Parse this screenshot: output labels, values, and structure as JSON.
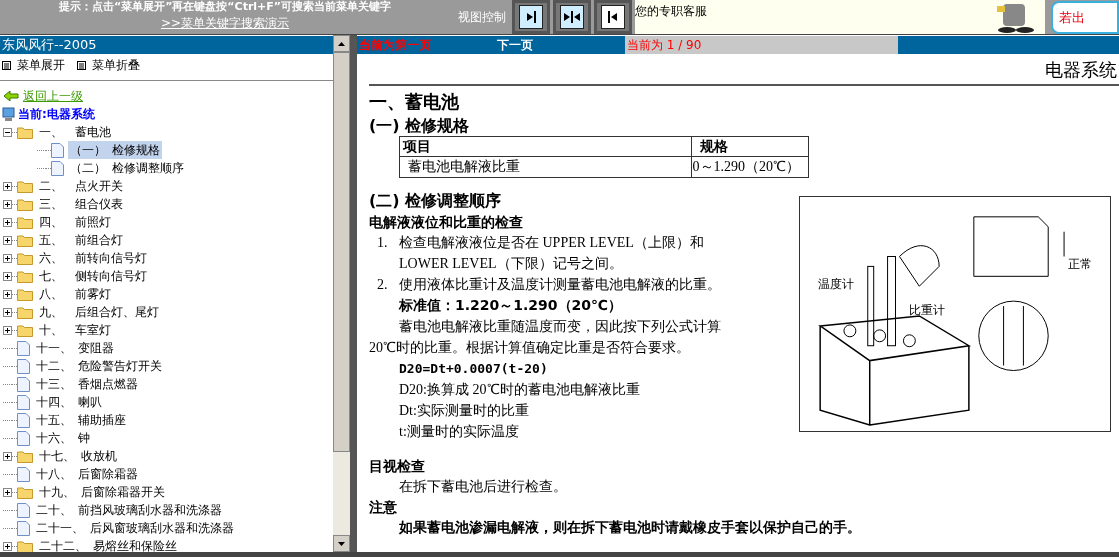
{
  "banner": {
    "hint": "提示：点击“菜单展开”再在键盘按“Ctrl+F”可搜索当前菜单关键字",
    "demo_link": ">>菜单关键字搜索演示",
    "view_label": "视图控制",
    "view_buttons": [
      {
        "kind": "right",
        "selected": true
      },
      {
        "kind": "split",
        "selected": true
      },
      {
        "kind": "left",
        "selected": false
      }
    ],
    "service": "您的专职客服",
    "badge": "若出"
  },
  "sidebar": {
    "title": "东风风行--2005",
    "menu_buttons": [
      "菜单展开",
      "菜单折叠"
    ],
    "back_link": "返回上一级",
    "current": "当前:电器系统",
    "tree": [
      {
        "num": "一、",
        "label": "蓄电池",
        "kind": "folder",
        "expanded": true,
        "children": [
          {
            "num": "（一）",
            "label": "检修规格",
            "kind": "page",
            "selected": true
          },
          {
            "num": "（二）",
            "label": "检修调整顺序",
            "kind": "page",
            "selected": false
          }
        ]
      },
      {
        "num": "二、",
        "label": "点火开关",
        "kind": "folder",
        "expanded": false
      },
      {
        "num": "三、",
        "label": "组合仪表",
        "kind": "folder",
        "expanded": false
      },
      {
        "num": "四、",
        "label": "前照灯",
        "kind": "folder",
        "expanded": false
      },
      {
        "num": "五、",
        "label": "前组合灯",
        "kind": "folder",
        "expanded": false
      },
      {
        "num": "六、",
        "label": "前转向信号灯",
        "kind": "folder",
        "expanded": false
      },
      {
        "num": "七、",
        "label": "侧转向信号灯",
        "kind": "folder",
        "expanded": false
      },
      {
        "num": "八、",
        "label": "前雾灯",
        "kind": "folder",
        "expanded": false
      },
      {
        "num": "九、",
        "label": "后组合灯、尾灯",
        "kind": "folder",
        "expanded": false
      },
      {
        "num": "十、",
        "label": "车室灯",
        "kind": "folder",
        "expanded": false
      },
      {
        "num": "十一、",
        "label": "变阻器",
        "kind": "page",
        "selected": false
      },
      {
        "num": "十二、",
        "label": "危险警告灯开关",
        "kind": "page",
        "selected": false
      },
      {
        "num": "十三、",
        "label": "香烟点燃器",
        "kind": "page",
        "selected": false
      },
      {
        "num": "十四、",
        "label": "喇叭",
        "kind": "page",
        "selected": false
      },
      {
        "num": "十五、",
        "label": "辅助插座",
        "kind": "page",
        "selected": false
      },
      {
        "num": "十六、",
        "label": "钟",
        "kind": "page",
        "selected": false
      },
      {
        "num": "十七、",
        "label": "收放机",
        "kind": "folder",
        "expanded": false
      },
      {
        "num": "十八、",
        "label": "后窗除霜器",
        "kind": "page",
        "selected": false
      },
      {
        "num": "十九、",
        "label": "后窗除霜器开关",
        "kind": "folder",
        "expanded": false
      },
      {
        "num": "二十、",
        "label": "前挡风玻璃刮水器和洗涤器",
        "kind": "page",
        "selected": false
      },
      {
        "num": "二十一、",
        "label": "后风窗玻璃刮水器和洗涤器",
        "kind": "page",
        "selected": false
      },
      {
        "num": "二十二、",
        "label": "易熔丝和保险丝",
        "kind": "folder",
        "expanded": false
      }
    ]
  },
  "page_nav": {
    "first_page": "当前为第一页",
    "next_page": "下一页",
    "counter": "当前为 1 / 90"
  },
  "document": {
    "header": "电器系统",
    "title": "一、蓄电池",
    "spec_heading": "(一) 检修规格",
    "table": {
      "columns": [
        "项目",
        "规格"
      ],
      "rows": [
        [
          "蓄电池电解液比重",
          "0～1.290（20℃）"
        ]
      ]
    },
    "blocks": [
      {
        "kind": "h2",
        "lines": [
          "(二) 检修调整顺序"
        ]
      },
      {
        "kind": "h3",
        "lines": [
          "电解液液位和比重的检查"
        ]
      },
      {
        "kind": "step",
        "num": "1.",
        "lines": [
          "检查电解液液位是否在 UPPER LEVEL（上限）和",
          "LOWER LEVEL（下限）记号之间。"
        ]
      },
      {
        "kind": "step",
        "num": "2.",
        "lines": [
          "使用液体比重计及温度计测量蓄电池电解液的比重。"
        ]
      },
      {
        "kind": "value",
        "lines": [
          "标准值：1.220～1.290（20℃）"
        ]
      },
      {
        "kind": "para",
        "lines": [
          "蓄电池电解液比重随温度而变，因此按下列公式计算",
          "20℃时的比重。根据计算值确定比重是否符合要求。"
        ]
      },
      {
        "kind": "formula",
        "lines": [
          "D20=Dt+0.0007(t-20)"
        ]
      },
      {
        "kind": "note",
        "lines": [
          "D20:换算成 20℃时的蓄电池电解液比重"
        ]
      },
      {
        "kind": "note",
        "lines": [
          "Dt:实际测量时的比重"
        ]
      },
      {
        "kind": "note",
        "lines": [
          "t:测量时的实际温度"
        ]
      }
    ],
    "figure_labels": [
      "温度计",
      "比重计",
      "正常"
    ],
    "after": [
      {
        "kind": "h3",
        "lines": [
          "目视检查"
        ]
      },
      {
        "kind": "indent",
        "lines": [
          "在拆下蓄电池后进行检查。"
        ]
      },
      {
        "kind": "h3",
        "lines": [
          "注意"
        ]
      },
      {
        "kind": "warn",
        "lines": [
          "如果蓄电池渗漏电解液，则在拆下蓄电池时请戴橡皮手套以保护自己的手。"
        ]
      }
    ]
  }
}
